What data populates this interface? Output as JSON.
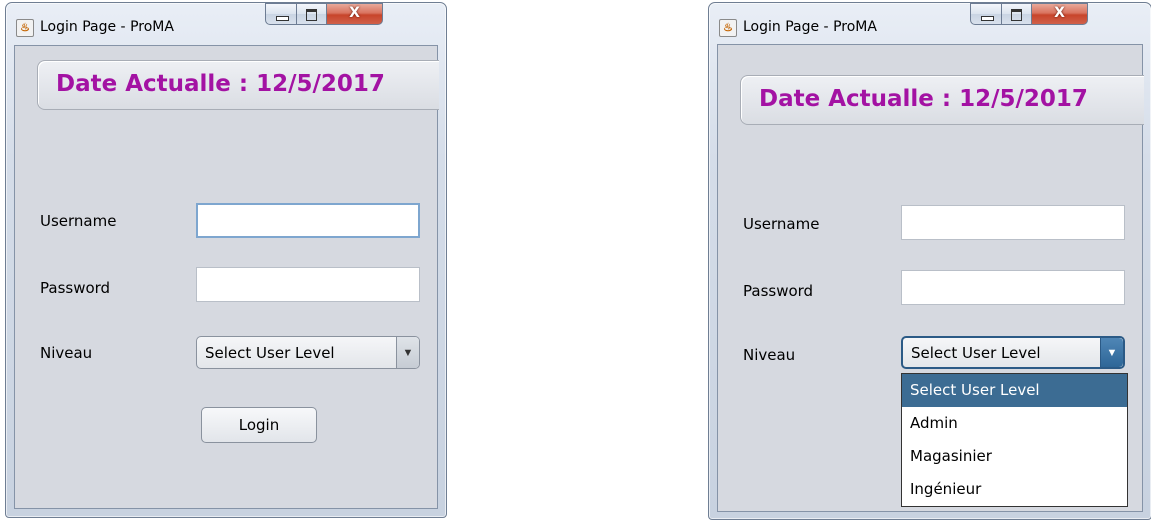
{
  "window_left": {
    "title": "Login Page - ProMA",
    "date_label": "Date Actualle : 12/5/2017",
    "form": {
      "username_label": "Username",
      "username_value": "",
      "password_label": "Password",
      "password_value": "",
      "niveau_label": "Niveau",
      "level_selected": "Select User Level",
      "login_button": "Login"
    }
  },
  "window_right": {
    "title": "Login Page - ProMA",
    "date_label": "Date Actualle : 12/5/2017",
    "form": {
      "username_label": "Username",
      "username_value": "",
      "password_label": "Password",
      "password_value": "",
      "niveau_label": "Niveau",
      "level_selected": "Select User Level"
    },
    "dropdown_options": [
      "Select User Level",
      "Admin",
      "Magasinier",
      "Ingénieur"
    ],
    "dropdown_highlighted": "Select User Level"
  },
  "window_buttons": {
    "close_glyph": "X"
  },
  "icons": [
    "java-app-icon",
    "minimize-icon",
    "maximize-icon",
    "close-icon",
    "dropdown-arrow-icon"
  ],
  "colors": {
    "date_text": "#a312a3",
    "dropdown_highlight": "#3c6c93",
    "focus_border": "#7ea6cf"
  }
}
